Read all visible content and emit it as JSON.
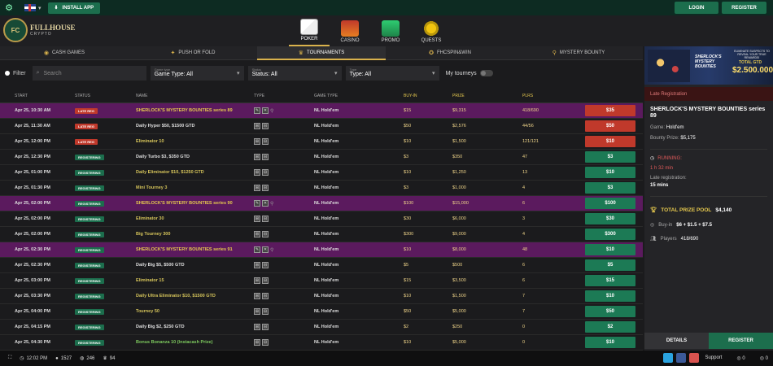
{
  "topbar": {
    "install_label": "INSTALL APP",
    "login_label": "LOGIN",
    "register_label": "REGISTER"
  },
  "logo": {
    "mark": "FC",
    "name": "FULLHOUSE",
    "tagline": "CRYPTO"
  },
  "main_nav": [
    {
      "label": "POKER",
      "active": true
    },
    {
      "label": "CASINO"
    },
    {
      "label": "PROMO"
    },
    {
      "label": "QUESTS"
    }
  ],
  "sub_nav": [
    {
      "label": "CASH GAMES"
    },
    {
      "label": "PUSH OR FOLD"
    },
    {
      "label": "TOURNAMENTS",
      "active": true
    },
    {
      "label": "FHCSPIN&WIN"
    },
    {
      "label": "MYSTERY BOUNTY"
    }
  ],
  "filters": {
    "filter_label": "Filter",
    "search_placeholder": "Search",
    "game_type_caption": "Game type",
    "game_type": "Game Type: All",
    "status_caption": "Status",
    "status": "Status: All",
    "type_caption": "Type",
    "type": "Type: All",
    "my_tourneys": "My tourneys"
  },
  "columns": {
    "start": "START",
    "status": "STATUS",
    "name": "NAME",
    "type": "TYPE",
    "game_type": "GAME TYPE",
    "buyin": "BUY-IN",
    "prize": "PRIZE",
    "plrs": "PLRS"
  },
  "rows": [
    {
      "start": "Apr 25, 10:30 AM",
      "status": "LATE REG",
      "name": "SHERLOCK'S MYSTERY BOUNTIES series 89",
      "game": "NL Hold'em",
      "buyin": "$15",
      "prize": "$9,315",
      "plrs": "418/690",
      "btn": "$35"
    },
    {
      "start": "Apr 25, 11:30 AM",
      "status": "LATE REG",
      "name": "Daily Hyper $50, $1500 GTD",
      "game": "NL Hold'em",
      "buyin": "$50",
      "prize": "$2,576",
      "plrs": "44/56",
      "btn": "$50"
    },
    {
      "start": "Apr 25, 12:00 PM",
      "status": "LATE REG",
      "name": "Eliminator 10",
      "game": "NL Hold'em",
      "buyin": "$10",
      "prize": "$1,500",
      "plrs": "121/121",
      "btn": "$10"
    },
    {
      "start": "Apr 25, 12:30 PM",
      "status": "REGISTERING",
      "name": "Daily Turbo $3, $350 GTD",
      "game": "NL Hold'em",
      "buyin": "$3",
      "prize": "$350",
      "plrs": "47",
      "btn": "$3"
    },
    {
      "start": "Apr 25, 01:00 PM",
      "status": "REGISTERING",
      "name": "Daily Eliminator $10, $1250 GTD",
      "game": "NL Hold'em",
      "buyin": "$10",
      "prize": "$1,250",
      "plrs": "13",
      "btn": "$10"
    },
    {
      "start": "Apr 25, 01:30 PM",
      "status": "REGISTERING",
      "name": "Mini Tourney 3",
      "game": "NL Hold'em",
      "buyin": "$3",
      "prize": "$1,000",
      "plrs": "4",
      "btn": "$3"
    },
    {
      "start": "Apr 25, 02:00 PM",
      "status": "REGISTERING",
      "name": "SHERLOCK'S MYSTERY BOUNTIES series 90",
      "game": "NL Hold'em",
      "buyin": "$100",
      "prize": "$15,000",
      "plrs": "6",
      "btn": "$100"
    },
    {
      "start": "Apr 25, 02:00 PM",
      "status": "REGISTERING",
      "name": "Eliminator 30",
      "game": "NL Hold'em",
      "buyin": "$30",
      "prize": "$6,000",
      "plrs": "3",
      "btn": "$30"
    },
    {
      "start": "Apr 25, 02:00 PM",
      "status": "REGISTERING",
      "name": "Big Tourney 300",
      "game": "NL Hold'em",
      "buyin": "$300",
      "prize": "$9,000",
      "plrs": "4",
      "btn": "$300"
    },
    {
      "start": "Apr 25, 02:30 PM",
      "status": "REGISTERING",
      "name": "SHERLOCK'S MYSTERY BOUNTIES series 91",
      "game": "NL Hold'em",
      "buyin": "$10",
      "prize": "$8,000",
      "plrs": "48",
      "btn": "$10"
    },
    {
      "start": "Apr 25, 02:30 PM",
      "status": "REGISTERING",
      "name": "Daily Big $5, $500 GTD",
      "game": "NL Hold'em",
      "buyin": "$5",
      "prize": "$500",
      "plrs": "6",
      "btn": "$5"
    },
    {
      "start": "Apr 25, 03:00 PM",
      "status": "REGISTERING",
      "name": "Eliminator 15",
      "game": "NL Hold'em",
      "buyin": "$15",
      "prize": "$3,500",
      "plrs": "6",
      "btn": "$15"
    },
    {
      "start": "Apr 25, 03:30 PM",
      "status": "REGISTERING",
      "name": "Daily Ultra Eliminator $10, $1500 GTD",
      "game": "NL Hold'em",
      "buyin": "$10",
      "prize": "$1,500",
      "plrs": "7",
      "btn": "$10"
    },
    {
      "start": "Apr 25, 04:00 PM",
      "status": "REGISTERING",
      "name": "Tourney 50",
      "game": "NL Hold'em",
      "buyin": "$50",
      "prize": "$5,000",
      "plrs": "7",
      "btn": "$50"
    },
    {
      "start": "Apr 25, 04:15 PM",
      "status": "REGISTERING",
      "name": "Daily Big $2, $250 GTD",
      "game": "NL Hold'em",
      "buyin": "$2",
      "prize": "$250",
      "plrs": "0",
      "btn": "$2"
    },
    {
      "start": "Apr 25, 04:30 PM",
      "status": "REGISTERING",
      "name": "Bonus Bonanza 10 (Instacash Prize)",
      "game": "NL Hold'em",
      "buyin": "$10",
      "prize": "$5,000",
      "plrs": "0",
      "btn": "$10"
    }
  ],
  "side": {
    "banner_title": "SHERLOCK'S MYSTERY BOUNTIES",
    "banner_sub": "ELIMINATE SUSPECTS TO REVEAL YOUR TRUE REWARDS!",
    "banner_total": "TOTAL GTD",
    "banner_amount": "$2.500.000",
    "late_reg": "Late Registration",
    "title": "SHERLOCK'S MYSTERY BOUNTIES series 89",
    "game_label": "Game:",
    "game_value": "Hold'em",
    "bounty_label": "Bounty Prize:",
    "bounty_value": "$5,175",
    "running": "RUNNING:",
    "run_time": "1 h 32 min",
    "late_reg_label": "Late registration:",
    "late_reg_value": "15 mins",
    "pool_label": "TOTAL PRIZE POOL",
    "pool_value": "$4,140",
    "buyin_label": "Buy-in",
    "buyin_value": "$6 + $1.5 + $7.5",
    "players_label": "Players",
    "players_value": "418/690",
    "details_label": "DETAILS",
    "register_label": "REGISTER"
  },
  "bottom": {
    "time": "12:02 PM",
    "online": "1527",
    "tables": "246",
    "tourneys": "94",
    "support": "Support",
    "count_a": "0",
    "count_b": "0"
  },
  "colors": {
    "accent": "#1c6e4d",
    "late": "#c0392b",
    "featured": "#5b1a5e",
    "gold": "#d9b24c"
  }
}
